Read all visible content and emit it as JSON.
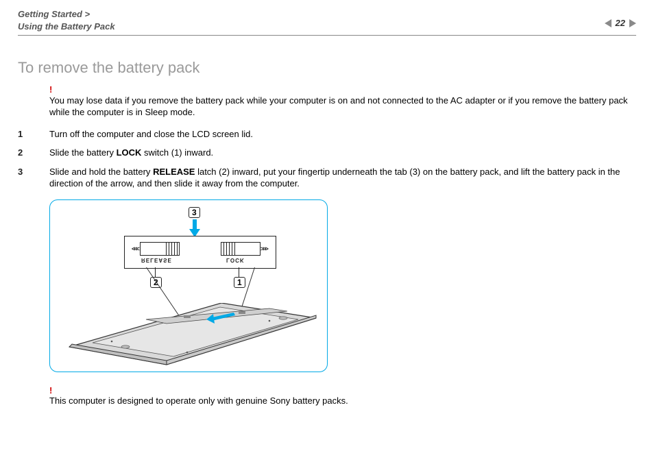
{
  "breadcrumb": {
    "line1": "Getting Started >",
    "line2": "Using the Battery Pack"
  },
  "page_number": "22",
  "title": "To remove the battery pack",
  "warning": {
    "mark": "!",
    "text": "You may lose data if you remove the battery pack while your computer is on and not connected to the AC adapter or if you remove the battery pack while the computer is in Sleep mode."
  },
  "steps": [
    {
      "num": "1",
      "pre": "Turn off the computer and close the LCD screen lid.",
      "bold": "",
      "post": ""
    },
    {
      "num": "2",
      "pre": "Slide the battery ",
      "bold": "LOCK",
      "post": " switch (1) inward."
    },
    {
      "num": "3",
      "pre": "Slide and hold the battery ",
      "bold": "RELEASE",
      "post": " latch (2) inward, put your fingertip underneath the tab (3) on the battery pack, and lift the battery pack in the direction of the arrow, and then slide it away from the computer."
    }
  ],
  "figure": {
    "callouts": {
      "c1": "1",
      "c2": "2",
      "c3": "3"
    },
    "labels": {
      "release": "RELEASE",
      "lock": "LOCK"
    }
  },
  "footnote": {
    "mark": "!",
    "text": "This computer is designed to operate only with genuine Sony battery packs."
  }
}
